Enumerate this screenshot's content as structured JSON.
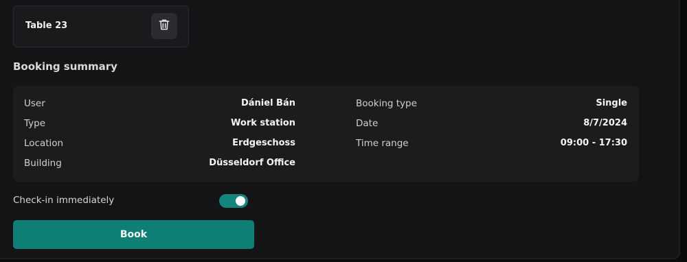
{
  "table_card": {
    "name": "Table 23",
    "delete_icon": "trash-icon"
  },
  "summary": {
    "title": "Booking summary",
    "left": [
      {
        "label": "User",
        "value": "Dániel Bán"
      },
      {
        "label": "Type",
        "value": "Work station"
      },
      {
        "label": "Location",
        "value": "Erdgeschoss"
      },
      {
        "label": "Building",
        "value": "Düsseldorf Office"
      }
    ],
    "right": [
      {
        "label": "Booking type",
        "value": "Single"
      },
      {
        "label": "Date",
        "value": "8/7/2024"
      },
      {
        "label": "Time range",
        "value": "09:00 - 17:30"
      }
    ]
  },
  "checkin": {
    "label": "Check-in immediately",
    "enabled": true
  },
  "book_button": {
    "label": "Book"
  },
  "colors": {
    "accent": "#0e7f74",
    "toggle_on": "#14857a",
    "background": "#141416",
    "surface": "#1c1c1f"
  }
}
